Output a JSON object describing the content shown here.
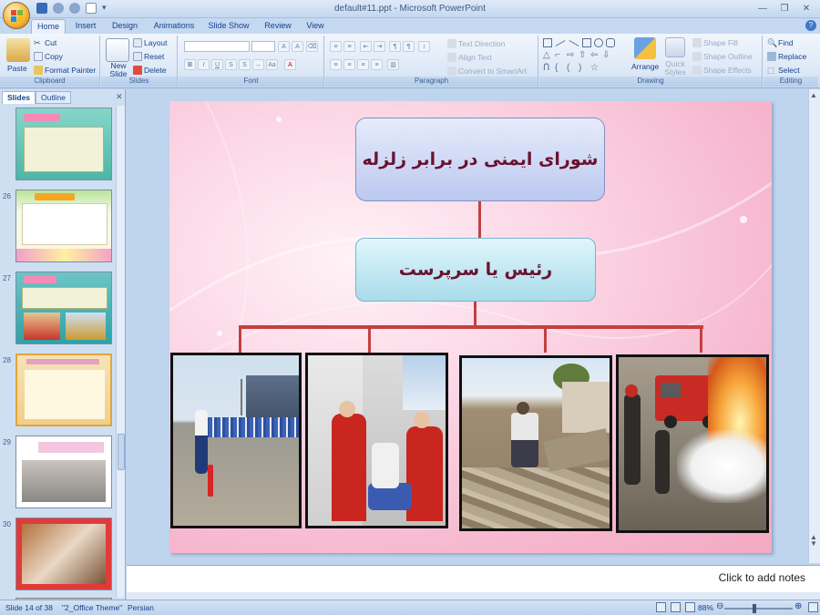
{
  "titlebar": {
    "title": "default#11.ppt - Microsoft PowerPoint"
  },
  "tabs": [
    "Home",
    "Insert",
    "Design",
    "Animations",
    "Slide Show",
    "Review",
    "View"
  ],
  "ribbon": {
    "clipboard": {
      "paste": "Paste",
      "cut": "Cut",
      "copy": "Copy",
      "format_painter": "Format Painter",
      "label": "Clipboard"
    },
    "slides": {
      "new_slide": "New Slide",
      "layout": "Layout",
      "reset": "Reset",
      "delete": "Delete",
      "label": "Slides"
    },
    "font": {
      "label": "Font"
    },
    "paragraph": {
      "text_direction": "Text Direction",
      "align_text": "Align Text",
      "convert_smartart": "Convert to SmartArt",
      "label": "Paragraph"
    },
    "drawing": {
      "arrange": "Arrange",
      "quick_styles": "Quick Styles",
      "shape_fill": "Shape Fill",
      "shape_outline": "Shape Outline",
      "shape_effects": "Shape Effects",
      "label": "Drawing"
    },
    "editing": {
      "find": "Find",
      "replace": "Replace",
      "select": "Select",
      "label": "Editing"
    }
  },
  "panel": {
    "tab_slides": "Slides",
    "tab_outline": "Outline",
    "slide_numbers": [
      "26",
      "27",
      "28",
      "29",
      "30"
    ]
  },
  "slide": {
    "title": "شورای ایمنی در برابر زلزله",
    "subtitle": "رئیس یا سرپرست"
  },
  "notes": {
    "placeholder": "Click to add notes"
  },
  "status": {
    "slide_info": "Slide 14 of 38",
    "theme": "\"2_Office Theme\"",
    "language": "Persian",
    "zoom": "88%"
  }
}
